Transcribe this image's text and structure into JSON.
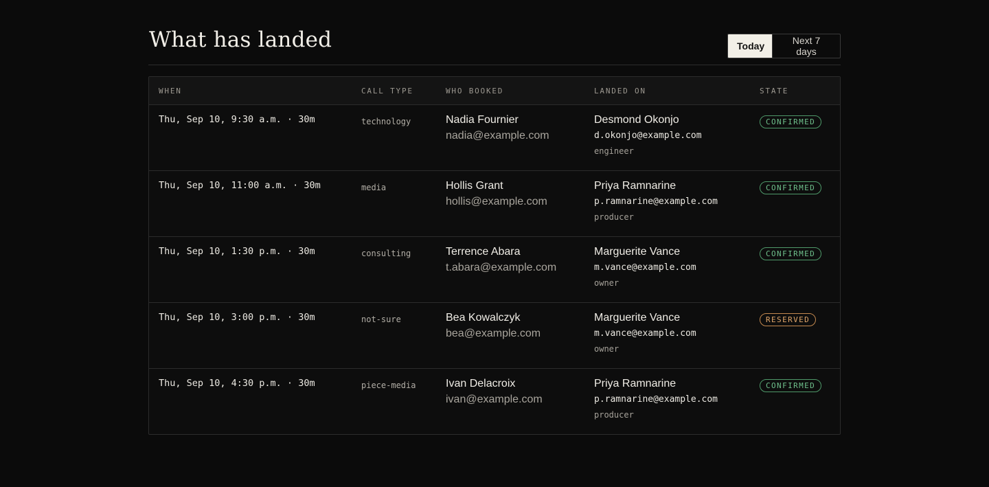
{
  "header": {
    "title": "What has landed",
    "toggle": {
      "today_label": "Today",
      "next7_label": "Next 7 days"
    }
  },
  "table": {
    "columns": {
      "when": "WHEN",
      "call_type": "CALL TYPE",
      "who_booked": "WHO BOOKED",
      "landed_on": "LANDED ON",
      "state": "STATE"
    },
    "rows": [
      {
        "when": "Thu, Sep 10, 9:30 a.m. · 30m",
        "call_type": "technology",
        "who_name": "Nadia Fournier",
        "who_email": "nadia@example.com",
        "landed_name": "Desmond Okonjo",
        "landed_email": "d.okonjo@example.com",
        "landed_role": "engineer",
        "state": "CONFIRMED"
      },
      {
        "when": "Thu, Sep 10, 11:00 a.m. · 30m",
        "call_type": "media",
        "who_name": "Hollis Grant",
        "who_email": "hollis@example.com",
        "landed_name": "Priya Ramnarine",
        "landed_email": "p.ramnarine@example.com",
        "landed_role": "producer",
        "state": "CONFIRMED"
      },
      {
        "when": "Thu, Sep 10, 1:30 p.m. · 30m",
        "call_type": "consulting",
        "who_name": "Terrence Abara",
        "who_email": "t.abara@example.com",
        "landed_name": "Marguerite Vance",
        "landed_email": "m.vance@example.com",
        "landed_role": "owner",
        "state": "CONFIRMED"
      },
      {
        "when": "Thu, Sep 10, 3:00 p.m. · 30m",
        "call_type": "not-sure",
        "who_name": "Bea Kowalczyk",
        "who_email": "bea@example.com",
        "landed_name": "Marguerite Vance",
        "landed_email": "m.vance@example.com",
        "landed_role": "owner",
        "state": "RESERVED"
      },
      {
        "when": "Thu, Sep 10, 4:30 p.m. · 30m",
        "call_type": "piece-media",
        "who_name": "Ivan Delacroix",
        "who_email": "ivan@example.com",
        "landed_name": "Priya Ramnarine",
        "landed_email": "p.ramnarine@example.com",
        "landed_role": "producer",
        "state": "CONFIRMED"
      }
    ]
  },
  "colors": {
    "background": "#0b0b0b",
    "confirmed": "#6fc08c",
    "reserved": "#e0a66a"
  }
}
